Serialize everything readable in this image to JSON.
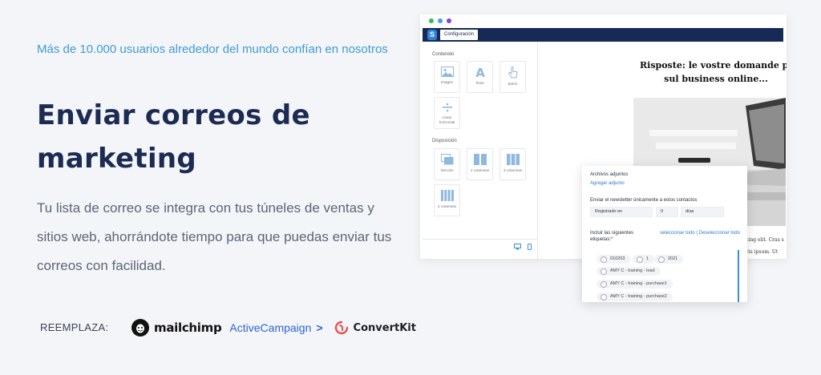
{
  "hero": {
    "kicker": "Más de 10.000 usuarios alrededor del mundo confían en nosotros",
    "headline": "Enviar correos de marketing",
    "description": "Tu lista de correo se integra con tus túneles de ventas y sitios web, ahorrándote tiempo para que puedas enviar tus correos con facilidad."
  },
  "replaces": {
    "label": "REEMPLAZA:",
    "brands": [
      "mailchimp",
      "ActiveCampaign",
      "ConvertKit"
    ]
  },
  "app": {
    "window_dots": [
      "#2fbf57",
      "#3aa0e8",
      "#8a3fd6"
    ],
    "logo_letter": "S",
    "config_label": "Configuración",
    "sidebar": {
      "content_title": "Contenido",
      "content_tiles": [
        {
          "label": "Imagen",
          "icon": "image-icon"
        },
        {
          "label": "Texto",
          "icon": "text-icon"
        },
        {
          "label": "Botón",
          "icon": "hand-pointer-icon"
        },
        {
          "label": "Línea horizontal",
          "icon": "divider-icon"
        }
      ],
      "layout_title": "Disposición",
      "layout_tiles": [
        {
          "label": "Sección",
          "icon": "section-icon"
        },
        {
          "label": "2 columnas",
          "icon": "two-columns-icon"
        },
        {
          "label": "3 columnas",
          "icon": "three-columns-icon"
        },
        {
          "label": "4 columnas",
          "icon": "four-columns-icon"
        }
      ]
    },
    "email": {
      "title_line1": "Risposte: le vostre domande più so",
      "title_line2": "sul business online...",
      "body_line1": "scing elit. Cras s",
      "body_line2": "uris ipsum. Ut"
    },
    "panel": {
      "attachments_label": "Archivos adjuntos",
      "add_attachment": "Agregar adjunto",
      "send_only_label": "Enviar el newsletter únicamente a estos contactos",
      "registered_in": "Registrado en",
      "days_value": "0",
      "days_unit": "días",
      "include_tags_label": "Incluir las siguientes etiquetas:*",
      "select_all": "seleccionar todo",
      "separator": "|",
      "deselect_all": "Deseleccionar todo",
      "tags": [
        "010203",
        "1",
        "2021",
        "AMY C - training - lead",
        "AMY C - training - purchase1",
        "AMY C - training - purchase2"
      ]
    }
  },
  "colors": {
    "accent": "#3f9bd6",
    "headline": "#1c2b53",
    "topbar": "#172a55",
    "activecampaign": "#2c63d8",
    "convertkit": "#e84e4e"
  }
}
